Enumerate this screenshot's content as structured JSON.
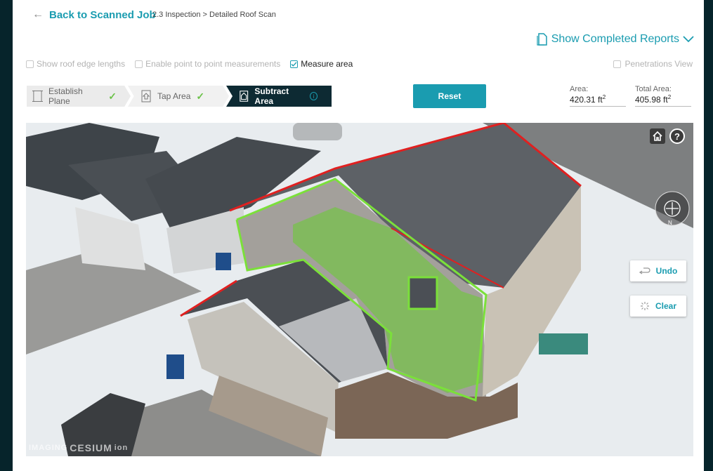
{
  "header": {
    "back_label": "Back to Scanned Job",
    "breadcrumb": "2.3 Inspection > Detailed Roof Scan",
    "reports_label": "Show Completed Reports"
  },
  "options": {
    "roof_edge": "Show roof edge lengths",
    "point_to_point": "Enable point to point measurements",
    "measure_area": "Measure area",
    "penetrations": "Penetrations View"
  },
  "steps": [
    {
      "label": "Establish Plane",
      "state": "done"
    },
    {
      "label": "Tap Area",
      "state": "done"
    },
    {
      "label": "Subtract Area",
      "state": "active"
    }
  ],
  "reset_label": "Reset",
  "metrics": {
    "area_label": "Area:",
    "area_value": "420.31 ft",
    "total_label": "Total Area:",
    "total_value": "405.98 ft",
    "unit_sup": "2"
  },
  "viewer": {
    "help_glyph": "?",
    "undo_label": "Undo",
    "clear_label": "Clear",
    "compass_n": "N",
    "credit_prefix": "IMAGING",
    "credit_brand": "CESIUM",
    "credit_suffix": "ion"
  },
  "colors": {
    "accent": "#1a9cb0",
    "check": "#6cc24a",
    "outline_green": "#7be03a",
    "outline_red": "#e02020"
  },
  "icons": {
    "back": "arrow-left-icon",
    "reports": "document-icon",
    "dropdown": "chevron-down-icon",
    "home": "home-icon",
    "help": "help-icon",
    "compass": "compass-icon",
    "undo": "undo-icon",
    "clear": "clear-icon"
  }
}
